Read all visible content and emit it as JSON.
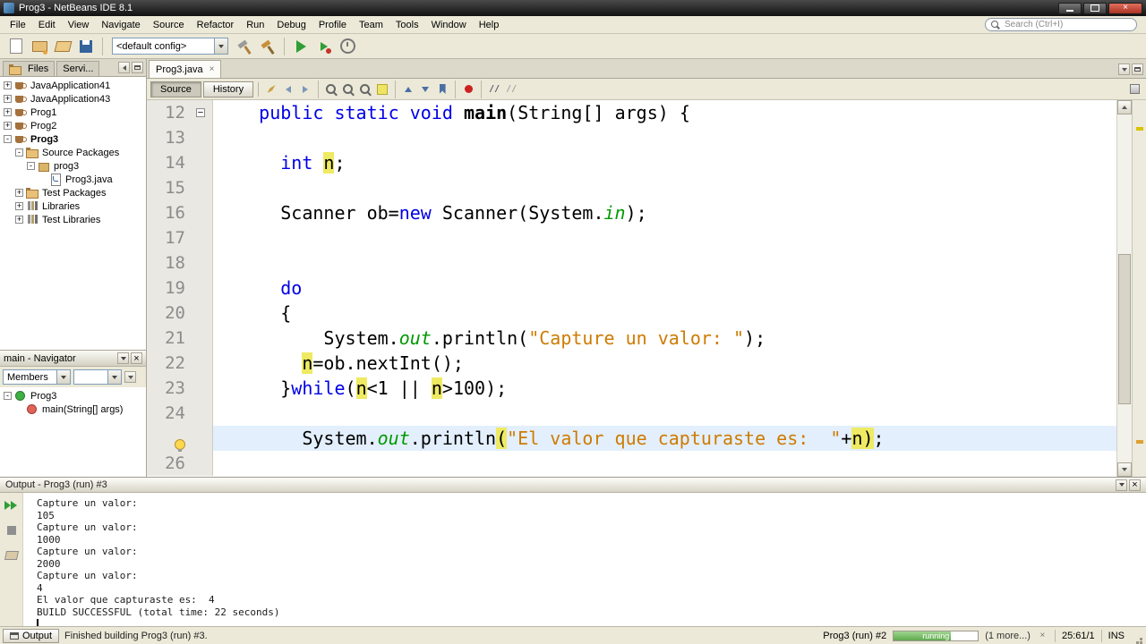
{
  "window": {
    "title": "Prog3 - NetBeans IDE 8.1"
  },
  "menubar": {
    "items": [
      "File",
      "Edit",
      "View",
      "Navigate",
      "Source",
      "Refactor",
      "Run",
      "Debug",
      "Profile",
      "Team",
      "Tools",
      "Window",
      "Help"
    ],
    "search_placeholder": "Search (Ctrl+I)"
  },
  "toolbar": {
    "config_value": "<default config>",
    "groups_before": [
      [
        "new-file-icon",
        "new-project-icon",
        "open-project-icon",
        "save-all-icon"
      ]
    ],
    "groups_after": [
      [
        "build-project-icon",
        "clean-build-icon"
      ],
      [
        "run-project-icon",
        "debug-project-icon",
        "profile-project-icon"
      ]
    ]
  },
  "projects": {
    "tabs": [
      {
        "label": "Files"
      },
      {
        "label": "Servi..."
      }
    ],
    "tree": [
      {
        "label": "JavaApplication41",
        "indent": 0,
        "handle": "+",
        "icon": "project"
      },
      {
        "label": "JavaApplication43",
        "indent": 0,
        "handle": "+",
        "icon": "project"
      },
      {
        "label": "Prog1",
        "indent": 0,
        "handle": "+",
        "icon": "project"
      },
      {
        "label": "Prog2",
        "indent": 0,
        "handle": "+",
        "icon": "project"
      },
      {
        "label": "Prog3",
        "indent": 0,
        "handle": "-",
        "icon": "project",
        "bold": true
      },
      {
        "label": "Source Packages",
        "indent": 1,
        "handle": "-",
        "icon": "package-root"
      },
      {
        "label": "prog3",
        "indent": 2,
        "handle": "-",
        "icon": "package"
      },
      {
        "label": "Prog3.java",
        "indent": 3,
        "handle": "",
        "icon": "java-file"
      },
      {
        "label": "Test Packages",
        "indent": 1,
        "handle": "+",
        "icon": "package-root"
      },
      {
        "label": "Libraries",
        "indent": 1,
        "handle": "+",
        "icon": "libraries"
      },
      {
        "label": "Test Libraries",
        "indent": 1,
        "handle": "+",
        "icon": "libraries"
      }
    ]
  },
  "navigator": {
    "title": "main - Navigator",
    "members_label": "Members",
    "tree": [
      {
        "label": "Prog3",
        "indent": 0,
        "handle": "-",
        "icon": "class"
      },
      {
        "label": "main(String[] args)",
        "indent": 1,
        "handle": "",
        "icon": "method-static"
      }
    ]
  },
  "editor": {
    "tab": "Prog3.java",
    "source_btn": "Source",
    "history_btn": "History",
    "toolbar_groups": [
      [
        "last-edited-icon",
        "back-icon",
        "forward-icon"
      ],
      [
        "find-selection-icon",
        "find-next-icon",
        "find-previous-icon",
        "toggle-highlight-icon"
      ],
      [
        "previous-bookmark-icon",
        "next-bookmark-icon",
        "toggle-bookmark-icon"
      ],
      [
        "record-macro-icon"
      ],
      [
        "comment-icon",
        "uncomment-icon"
      ]
    ],
    "lines": [
      {
        "num": "12",
        "fold": "-",
        "segs": [
          [
            "p",
            "    "
          ],
          [
            "k",
            "public"
          ],
          [
            "p",
            " "
          ],
          [
            "k",
            "static"
          ],
          [
            "p",
            " "
          ],
          [
            "k",
            "void"
          ],
          [
            "p",
            " "
          ],
          [
            "b",
            "main"
          ],
          [
            "p",
            "(String[] args) {"
          ]
        ]
      },
      {
        "num": "13",
        "segs": []
      },
      {
        "num": "14",
        "segs": [
          [
            "p",
            "      "
          ],
          [
            "k",
            "int"
          ],
          [
            "p",
            " "
          ],
          [
            "h",
            "n"
          ],
          [
            "p",
            ";"
          ]
        ]
      },
      {
        "num": "15",
        "segs": []
      },
      {
        "num": "16",
        "segs": [
          [
            "p",
            "      Scanner ob="
          ],
          [
            "k",
            "new"
          ],
          [
            "p",
            " Scanner(System."
          ],
          [
            "f",
            "in"
          ],
          [
            "p",
            ");"
          ]
        ]
      },
      {
        "num": "17",
        "segs": []
      },
      {
        "num": "18",
        "segs": []
      },
      {
        "num": "19",
        "segs": [
          [
            "p",
            "      "
          ],
          [
            "k",
            "do"
          ]
        ]
      },
      {
        "num": "20",
        "segs": [
          [
            "p",
            "      {"
          ]
        ]
      },
      {
        "num": "21",
        "segs": [
          [
            "p",
            "          System."
          ],
          [
            "f",
            "out"
          ],
          [
            "p",
            ".println("
          ],
          [
            "s",
            "\"Capture un valor: \""
          ],
          [
            "p",
            ");"
          ]
        ]
      },
      {
        "num": "22",
        "segs": [
          [
            "p",
            "        "
          ],
          [
            "h",
            "n"
          ],
          [
            "p",
            "=ob.nextInt();"
          ]
        ]
      },
      {
        "num": "23",
        "segs": [
          [
            "p",
            "      }"
          ],
          [
            "k",
            "while"
          ],
          [
            "p",
            "("
          ],
          [
            "h",
            "n"
          ],
          [
            "p",
            "<1 || "
          ],
          [
            "h",
            "n"
          ],
          [
            "p",
            ">100);"
          ]
        ]
      },
      {
        "num": "24",
        "segs": []
      },
      {
        "num": "25",
        "current": true,
        "bulb": true,
        "segs": [
          [
            "p",
            "        System."
          ],
          [
            "f",
            "out"
          ],
          [
            "p",
            ".println"
          ],
          [
            "h",
            "("
          ],
          [
            "s",
            "\"El valor que capturaste es:  \""
          ],
          [
            "p",
            "+"
          ],
          [
            "h",
            "n"
          ],
          [
            "h",
            ")"
          ],
          [
            "p",
            ";"
          ]
        ]
      },
      {
        "num": "26",
        "segs": []
      }
    ]
  },
  "output": {
    "title": "Output - Prog3 (run) #3",
    "gutter_icons": [
      "rerun-icon",
      "stop-icon",
      "clear-output-icon"
    ],
    "lines": [
      "Capture un valor:",
      "105",
      "Capture un valor:",
      "1000",
      "Capture un valor:",
      "2000",
      "Capture un valor:",
      "4",
      "El valor que capturaste es:  4",
      "BUILD SUCCESSFUL (total time: 22 seconds)"
    ]
  },
  "statusbar": {
    "output_tab": "Output",
    "message": "Finished building Prog3 (run) #3.",
    "run_label": "Prog3 (run) #2",
    "progress_label": "running",
    "more_label": "(1 more...)",
    "caret": "25:61/1",
    "mode": "INS"
  },
  "colors": {
    "keyword": "#0000e6",
    "string": "#ce7b00",
    "field": "#009900",
    "occurrence": "#eeea63",
    "current_line": "#e3effc",
    "run_green": "#2f9e36"
  }
}
